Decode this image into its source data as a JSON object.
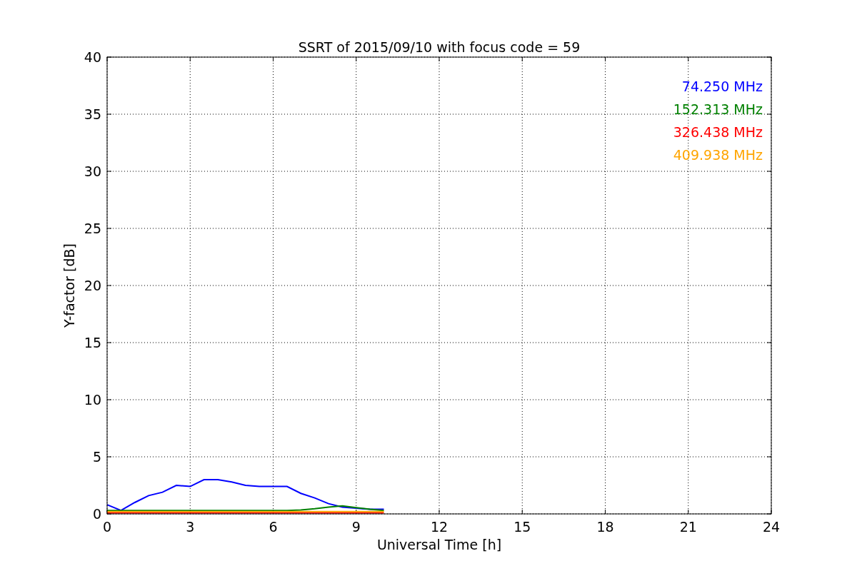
{
  "chart_data": {
    "type": "line",
    "title": "SSRT of 2015/09/10 with focus code = 59",
    "xlabel": "Universal Time [h]",
    "ylabel": "Y-factor [dB]",
    "x": [
      0,
      0.5,
      1,
      1.5,
      2,
      2.5,
      3,
      3.5,
      4,
      4.5,
      5,
      5.5,
      6,
      6.5,
      7,
      7.5,
      8,
      8.5,
      9,
      9.5,
      10
    ],
    "series": [
      {
        "name": "74.250 MHz",
        "color": "#0000ff",
        "values": [
          0.8,
          0.3,
          1.0,
          1.6,
          1.9,
          2.5,
          2.4,
          3.0,
          3.0,
          2.8,
          2.5,
          2.4,
          2.4,
          2.4,
          1.8,
          1.4,
          0.9,
          0.6,
          0.5,
          0.4,
          0.4
        ]
      },
      {
        "name": "152.313 MHz",
        "color": "#008000",
        "values": [
          0.3,
          0.3,
          0.3,
          0.3,
          0.3,
          0.3,
          0.3,
          0.3,
          0.3,
          0.3,
          0.3,
          0.3,
          0.3,
          0.3,
          0.35,
          0.45,
          0.6,
          0.7,
          0.55,
          0.4,
          0.3
        ]
      },
      {
        "name": "326.438 MHz",
        "color": "#ff0000",
        "values": [
          0.1,
          0.1,
          0.1,
          0.1,
          0.1,
          0.1,
          0.1,
          0.1,
          0.1,
          0.1,
          0.1,
          0.1,
          0.1,
          0.1,
          0.1,
          0.1,
          0.1,
          0.1,
          0.1,
          0.1,
          0.1
        ]
      },
      {
        "name": "409.938 MHz",
        "color": "#ffa500",
        "values": [
          0.2,
          0.2,
          0.2,
          0.2,
          0.2,
          0.2,
          0.2,
          0.2,
          0.2,
          0.2,
          0.2,
          0.2,
          0.2,
          0.2,
          0.2,
          0.2,
          0.2,
          0.2,
          0.2,
          0.2,
          0.2
        ]
      }
    ],
    "grid": true,
    "xlim": [
      0,
      24
    ],
    "ylim": [
      0,
      40
    ],
    "xticks": [
      0,
      3,
      6,
      9,
      12,
      15,
      18,
      21,
      24
    ],
    "yticks": [
      0,
      5,
      10,
      15,
      20,
      25,
      30,
      35,
      40
    ]
  }
}
